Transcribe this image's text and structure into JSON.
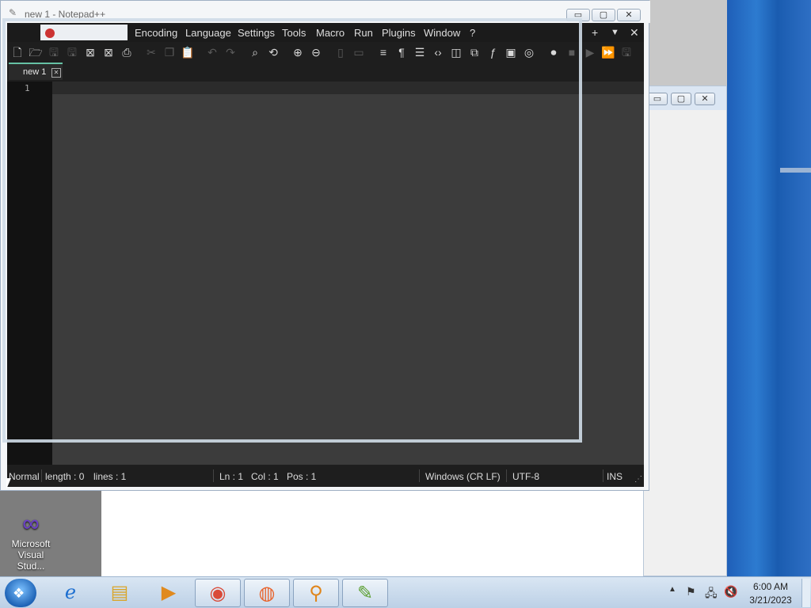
{
  "notepad": {
    "title": "new 1 - Notepad++",
    "menu": [
      "Encoding",
      "Language",
      "Settings",
      "Tools",
      "Macro",
      "Run",
      "Plugins",
      "Window",
      "?"
    ],
    "menu_right": {
      "add": "+",
      "dropdown": "▼",
      "close": "✕"
    },
    "tab": {
      "label": "new 1",
      "close": "✕"
    },
    "line_number": "1",
    "status": {
      "mode": "Normal",
      "length": "length : 0",
      "lines": "lines : 1",
      "ln": "Ln : 1",
      "col": "Col : 1",
      "pos": "Pos : 1",
      "eol": "Windows (CR LF)",
      "encoding": "UTF-8",
      "ins": "INS"
    },
    "window_controls": {
      "minimize": "▭",
      "maximize": "▢",
      "close": "✕"
    },
    "toolbar_icons": [
      "new-file-icon",
      "open-file-icon",
      "save-icon",
      "save-all-icon",
      "close-icon",
      "close-all-icon",
      "print-icon",
      "cut-icon",
      "copy-icon",
      "paste-icon",
      "undo-icon",
      "redo-icon",
      "find-icon",
      "replace-icon",
      "zoom-in-icon",
      "zoom-out-icon",
      "sync-vertical-icon",
      "sync-horizontal-icon",
      "word-wrap-icon",
      "show-all-chars-icon",
      "indent-guide-icon",
      "language-xml-icon",
      "document-map-icon",
      "doc-list-icon",
      "function-list-icon",
      "monitor-icon",
      "folder-workspace-icon",
      "record-macro-icon",
      "stop-macro-icon",
      "play-macro-icon",
      "play-multiple-icon",
      "save-macro-icon"
    ]
  },
  "background_window": {
    "controls": {
      "minimize": "▭",
      "maximize": "▢",
      "close": "✕"
    }
  },
  "desktop_icon": {
    "label_line1": "Microsoft",
    "label_line2": "Visual Stud..."
  },
  "taskbar": {
    "apps": [
      "windows-explorer-icon",
      "internet-explorer-icon",
      "file-explorer-icon",
      "media-player-icon",
      "chrome-icon",
      "firefox-icon",
      "search-magnifier-icon",
      "notepad-plus-plus-icon"
    ],
    "clock": {
      "time": "6:00 AM",
      "date": "3/21/2023"
    }
  },
  "colors": {
    "accent_tab": "#66c2a5",
    "editor_bg": "#3c3c3c",
    "gutter_bg": "#121212"
  }
}
